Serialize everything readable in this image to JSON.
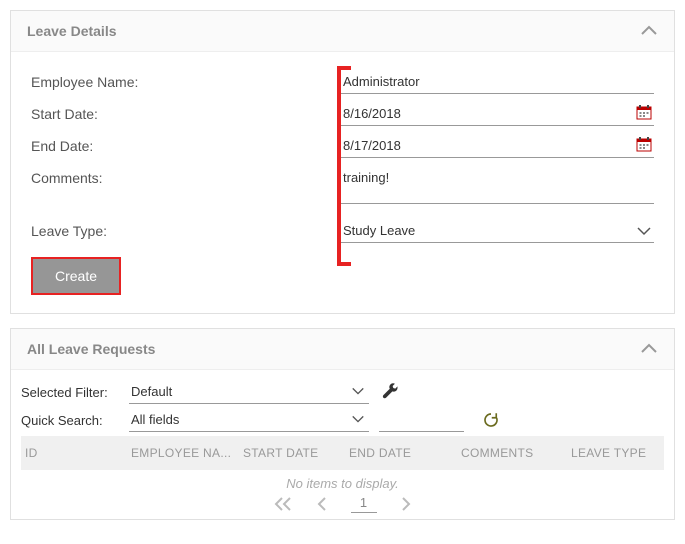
{
  "details": {
    "title": "Leave Details",
    "labels": {
      "employee": "Employee Name:",
      "start": "Start Date:",
      "end": "End Date:",
      "comments": "Comments:",
      "type": "Leave Type:"
    },
    "values": {
      "employee": "Administrator",
      "start": "8/16/2018",
      "end": "8/17/2018",
      "comments": "training!",
      "type": "Study Leave"
    },
    "create_label": "Create"
  },
  "requests": {
    "title": "All Leave Requests",
    "filter_label": "Selected Filter:",
    "filter_value": "Default",
    "search_label": "Quick Search:",
    "search_value": "All fields",
    "columns": {
      "id": "ID",
      "employee": "EMPLOYEE NA...",
      "start": "START DATE",
      "end": "END DATE",
      "comments": "COMMENTS",
      "type": "LEAVE TYPE"
    },
    "empty": "No items to display.",
    "page": "1"
  }
}
